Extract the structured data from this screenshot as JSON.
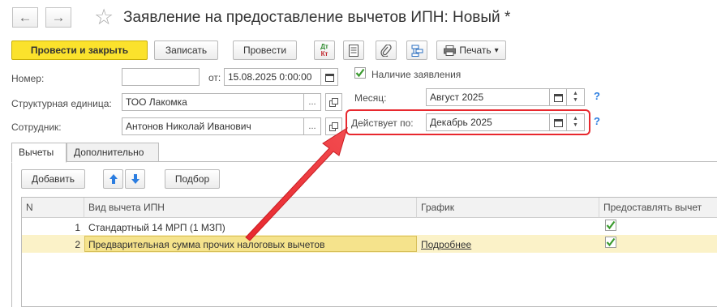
{
  "window": {
    "title": "Заявление на предоставление вычетов ИПН: Новый *",
    "back_glyph": "←",
    "forward_glyph": "→",
    "star_glyph": "☆"
  },
  "toolbar": {
    "post_close_label": "Провести и закрыть",
    "save_label": "Записать",
    "post_label": "Провести",
    "dt_label": "Дт",
    "kt_label": "Кт",
    "print_label": "Печать",
    "print_arrow": "▾"
  },
  "form": {
    "number_label": "Номер:",
    "number_value": "",
    "date_from_label": "от:",
    "date_value": "15.08.2025  0:00:00",
    "has_application_label": "Наличие заявления",
    "has_application_checked": true,
    "month_label": "Месяц:",
    "month_value": "Август 2025",
    "valid_label": "Действует по:",
    "valid_value": "Декабрь 2025",
    "unit_label": "Структурная единица:",
    "unit_value": "ТОО Лакомка",
    "employee_label": "Сотрудник:",
    "employee_value": "Антонов Николай Иванович",
    "dots": "...",
    "help_mark": "?"
  },
  "tabs": [
    {
      "label": "Вычеты",
      "active": true
    },
    {
      "label": "Дополнительно",
      "active": false
    }
  ],
  "table_toolbar": {
    "add_label": "Добавить",
    "select_label": "Подбор"
  },
  "table": {
    "columns": [
      "N",
      "Вид вычета ИПН",
      "График",
      "Предоставлять вычет"
    ],
    "rows": [
      {
        "n": "1",
        "kind": "Стандартный 14 МРП (1 МЗП)",
        "schedule": "",
        "provide": true
      },
      {
        "n": "2",
        "kind": "Предварительная сумма прочих налоговых вычетов",
        "schedule": "Подробнее",
        "provide": true
      }
    ]
  },
  "colors": {
    "primary_button": "#fbe22c",
    "highlight": "#e8282e",
    "check": "#3a9a2e",
    "help": "#2b7de0",
    "selected_row": "#fbf2c8",
    "selected_cell": "#f5e38c"
  }
}
